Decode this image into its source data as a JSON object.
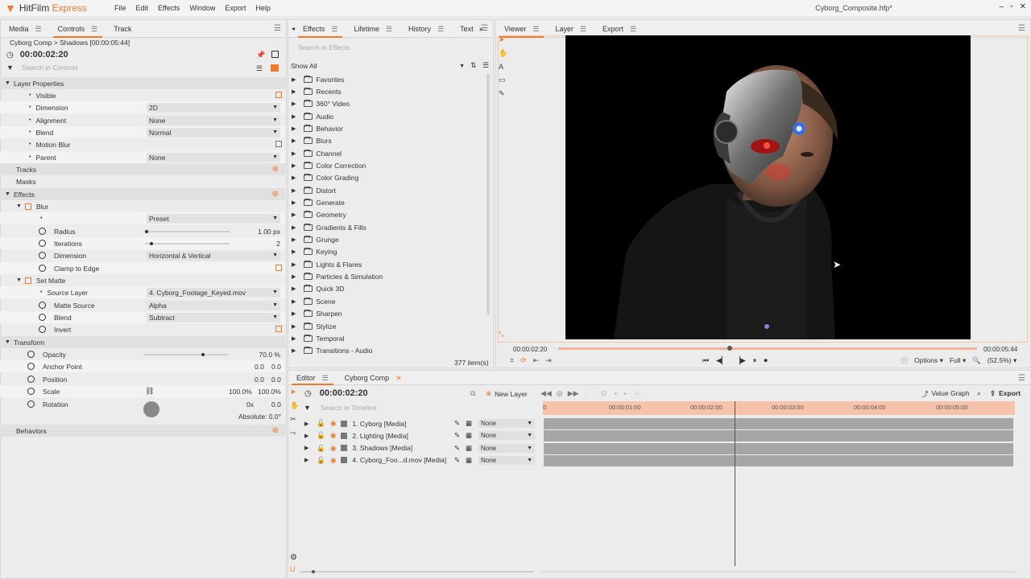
{
  "app": {
    "logo_brand": "HitFilm",
    "logo_suffix": "Express",
    "document_title": "Cyborg_Composite.hfp*",
    "menu": [
      "File",
      "Edit",
      "Effects",
      "Window",
      "Export",
      "Help"
    ]
  },
  "left_panel": {
    "tabs": [
      "Media",
      "Controls",
      "Track"
    ],
    "breadcrumb": "Cyborg Comp > Shadows [00:00:05:44]",
    "timecode": "00:00:02:20",
    "search_placeholder": "Search in Controls",
    "layer_properties": "Layer Properties",
    "rows": {
      "visible": "Visible",
      "dimension": "Dimension",
      "dimension_val": "2D",
      "alignment": "Alignment",
      "alignment_val": "None",
      "blend": "Blend",
      "blend_val": "Normal",
      "motion_blur": "Motion Blur",
      "parent": "Parent",
      "parent_val": "None",
      "tracks": "Tracks",
      "masks": "Masks",
      "effects": "Effects",
      "blur": "Blur",
      "preset_val": "Preset",
      "radius": "Radius",
      "radius_val": "1.00 px",
      "iterations": "Iterations",
      "iterations_val": "2",
      "blur_dimension": "Dimension",
      "blur_dimension_val": "Horizontal & Vertical",
      "clamp": "Clamp to Edge",
      "set_matte": "Set Matte",
      "source_layer": "Source Layer",
      "source_layer_val": "4. Cyborg_Footage_Keyed.mov",
      "matte_source": "Matte Source",
      "matte_source_val": "Alpha",
      "matte_blend": "Blend",
      "matte_blend_val": "Subtract",
      "invert": "Invert",
      "transform": "Transform",
      "opacity": "Opacity",
      "opacity_val": "70.0 %",
      "anchor": "Anchor Point",
      "anchor_x": "0.0",
      "anchor_y": "0.0",
      "position": "Position",
      "position_x": "0.0",
      "position_y": "0.0",
      "scale": "Scale",
      "scale_x": "100.0%",
      "scale_y": "100.0%",
      "rotation": "Rotation",
      "rotation_turns": "0x",
      "rotation_deg": "0.0",
      "absolute": "Absolute: 0.0°",
      "behaviors": "Behaviors"
    }
  },
  "effects_panel": {
    "tabs": [
      "Effects",
      "Lifetime",
      "History",
      "Text"
    ],
    "search_placeholder": "Search in Effects",
    "filter": "Show All",
    "count": "377 item(s)",
    "folders": [
      "Favorites",
      "Recents",
      "360° Video",
      "Audio",
      "Behavior",
      "Blurs",
      "Channel",
      "Color Correction",
      "Color Grading",
      "Distort",
      "Generate",
      "Geometry",
      "Gradients & Fills",
      "Grunge",
      "Keying",
      "Lights & Flares",
      "Particles & Simulation",
      "Quick 3D",
      "Scene",
      "Sharpen",
      "Stylize",
      "Temporal",
      "Transitions - Audio"
    ]
  },
  "viewer": {
    "tabs": [
      "Viewer",
      "Layer",
      "Export"
    ],
    "time_current": "00:00:02:20",
    "time_end": "00:00:05:44",
    "playhead_fraction": 0.41,
    "options": "Options",
    "quality": "Full",
    "zoom": "(52.5%)"
  },
  "editor": {
    "tabs": [
      "Editor",
      "Cyborg Comp"
    ],
    "timecode": "00:00:02:20",
    "new_layer": "New Layer",
    "value_graph": "Value Graph",
    "export": "Export",
    "search_placeholder": "Search in Timeline",
    "ruler": [
      "0",
      "00:00:01:00",
      "00:00:02:00",
      "00:00:03:00",
      "00:00:04:00",
      "00:00:05:00"
    ],
    "layers": [
      {
        "name": "1. Cyborg [Media]",
        "blend": "None"
      },
      {
        "name": "2. Lighting [Media]",
        "blend": "None"
      },
      {
        "name": "3. Shadows [Media]",
        "blend": "None"
      },
      {
        "name": "4. Cyborg_Foo...d.mov [Media]",
        "blend": "None"
      }
    ]
  },
  "colors": {
    "accent": "#f07a2b",
    "track": "#a6a6a6",
    "ruler": "#f6c3aa"
  }
}
